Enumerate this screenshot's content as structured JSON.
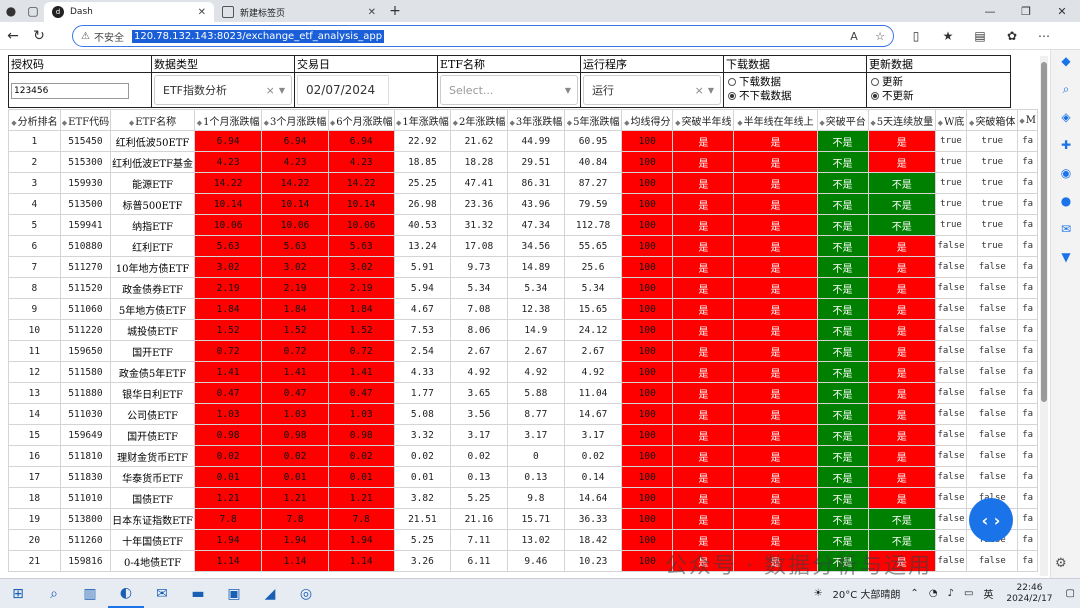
{
  "browser": {
    "tabs": [
      {
        "label": "Dash",
        "fav": "dash"
      },
      {
        "label": "新建标签页",
        "fav": "page"
      }
    ],
    "url": "120.78.132.143:8023/exchange_etf_analysis_app",
    "insecure_label": "不安全"
  },
  "controls": {
    "auth": {
      "label": "授权码",
      "value": "123456"
    },
    "datatype": {
      "label": "数据类型",
      "value": "ETF指数分析"
    },
    "tradedate": {
      "label": "交易日",
      "value": "02/07/2024"
    },
    "etfname": {
      "label": "ETF名称",
      "placeholder": "Select..."
    },
    "program": {
      "label": "运行程序",
      "value": "运行"
    },
    "download": {
      "label": "下载数据",
      "options": [
        "下载数据",
        "不下载数据"
      ],
      "selected": 1
    },
    "update": {
      "label": "更新数据",
      "options": [
        "更新",
        "不更新"
      ],
      "selected": 1
    }
  },
  "table": {
    "headers": [
      "分析排名",
      "ETF代码",
      "ETF名称",
      "1个月涨跌幅",
      "3个月涨跌幅",
      "6个月涨跌幅",
      "1年涨跌幅",
      "2年涨跌幅",
      "3年涨跌幅",
      "5年涨跌幅",
      "均线得分",
      "突破半年线",
      "半年线在年线上",
      "突破平台",
      "5天连续放量",
      "W底",
      "突破箱体",
      "M"
    ],
    "rows": [
      [
        "1",
        "515450",
        "红利低波50ETF",
        "6.94",
        "6.94",
        "6.94",
        "22.92",
        "21.62",
        "44.99",
        "60.95",
        "100",
        "是",
        "是",
        "不是",
        "是",
        "true",
        "true",
        "fa"
      ],
      [
        "2",
        "515300",
        "红利低波ETF基金",
        "4.23",
        "4.23",
        "4.23",
        "18.85",
        "18.28",
        "29.51",
        "40.84",
        "100",
        "是",
        "是",
        "不是",
        "是",
        "true",
        "true",
        "fa"
      ],
      [
        "3",
        "159930",
        "能源ETF",
        "14.22",
        "14.22",
        "14.22",
        "25.25",
        "47.41",
        "86.31",
        "87.27",
        "100",
        "是",
        "是",
        "不是",
        "不是",
        "true",
        "true",
        "fa"
      ],
      [
        "4",
        "513500",
        "标普500ETF",
        "10.14",
        "10.14",
        "10.14",
        "26.98",
        "23.36",
        "43.96",
        "79.59",
        "100",
        "是",
        "是",
        "不是",
        "不是",
        "true",
        "true",
        "fa"
      ],
      [
        "5",
        "159941",
        "纳指ETF",
        "10.06",
        "10.06",
        "10.06",
        "40.53",
        "31.32",
        "47.34",
        "112.78",
        "100",
        "是",
        "是",
        "不是",
        "不是",
        "true",
        "true",
        "fa"
      ],
      [
        "6",
        "510880",
        "红利ETF",
        "5.63",
        "5.63",
        "5.63",
        "13.24",
        "17.08",
        "34.56",
        "55.65",
        "100",
        "是",
        "是",
        "不是",
        "是",
        "false",
        "true",
        "fa"
      ],
      [
        "7",
        "511270",
        "10年地方债ETF",
        "3.02",
        "3.02",
        "3.02",
        "5.91",
        "9.73",
        "14.89",
        "25.6",
        "100",
        "是",
        "是",
        "不是",
        "是",
        "false",
        "false",
        "fa"
      ],
      [
        "8",
        "511520",
        "政金债券ETF",
        "2.19",
        "2.19",
        "2.19",
        "5.94",
        "5.34",
        "5.34",
        "5.34",
        "100",
        "是",
        "是",
        "不是",
        "是",
        "false",
        "false",
        "fa"
      ],
      [
        "9",
        "511060",
        "5年地方债ETF",
        "1.84",
        "1.84",
        "1.84",
        "4.67",
        "7.08",
        "12.38",
        "15.65",
        "100",
        "是",
        "是",
        "不是",
        "是",
        "false",
        "false",
        "fa"
      ],
      [
        "10",
        "511220",
        "城投债ETF",
        "1.52",
        "1.52",
        "1.52",
        "7.53",
        "8.06",
        "14.9",
        "24.12",
        "100",
        "是",
        "是",
        "不是",
        "是",
        "false",
        "false",
        "fa"
      ],
      [
        "11",
        "159650",
        "国开ETF",
        "0.72",
        "0.72",
        "0.72",
        "2.54",
        "2.67",
        "2.67",
        "2.67",
        "100",
        "是",
        "是",
        "不是",
        "是",
        "false",
        "false",
        "fa"
      ],
      [
        "12",
        "511580",
        "政金债5年ETF",
        "1.41",
        "1.41",
        "1.41",
        "4.33",
        "4.92",
        "4.92",
        "4.92",
        "100",
        "是",
        "是",
        "不是",
        "是",
        "false",
        "false",
        "fa"
      ],
      [
        "13",
        "511880",
        "银华日利ETF",
        "0.47",
        "0.47",
        "0.47",
        "1.77",
        "3.65",
        "5.88",
        "11.04",
        "100",
        "是",
        "是",
        "不是",
        "是",
        "false",
        "false",
        "fa"
      ],
      [
        "14",
        "511030",
        "公司债ETF",
        "1.03",
        "1.03",
        "1.03",
        "5.08",
        "3.56",
        "8.77",
        "14.67",
        "100",
        "是",
        "是",
        "不是",
        "是",
        "false",
        "false",
        "fa"
      ],
      [
        "15",
        "159649",
        "国开债ETF",
        "0.98",
        "0.98",
        "0.98",
        "3.32",
        "3.17",
        "3.17",
        "3.17",
        "100",
        "是",
        "是",
        "不是",
        "是",
        "false",
        "false",
        "fa"
      ],
      [
        "16",
        "511810",
        "理财金货币ETF",
        "0.02",
        "0.02",
        "0.02",
        "0.02",
        "0.02",
        "0",
        "0.02",
        "100",
        "是",
        "是",
        "不是",
        "是",
        "false",
        "false",
        "fa"
      ],
      [
        "17",
        "511830",
        "华泰货币ETF",
        "0.01",
        "0.01",
        "0.01",
        "0.01",
        "0.13",
        "0.13",
        "0.14",
        "100",
        "是",
        "是",
        "不是",
        "是",
        "false",
        "false",
        "fa"
      ],
      [
        "18",
        "511010",
        "国债ETF",
        "1.21",
        "1.21",
        "1.21",
        "3.82",
        "5.25",
        "9.8",
        "14.64",
        "100",
        "是",
        "是",
        "不是",
        "是",
        "false",
        "false",
        "fa"
      ],
      [
        "19",
        "513800",
        "日本东证指数ETF",
        "7.8",
        "7.8",
        "7.8",
        "21.51",
        "21.16",
        "15.71",
        "36.33",
        "100",
        "是",
        "是",
        "不是",
        "不是",
        "false",
        "false",
        "fa"
      ],
      [
        "20",
        "511260",
        "十年国债ETF",
        "1.94",
        "1.94",
        "1.94",
        "5.25",
        "7.11",
        "13.02",
        "18.42",
        "100",
        "是",
        "是",
        "不是",
        "不是",
        "false",
        "false",
        "fa"
      ],
      [
        "21",
        "159816",
        "0-4地债ETF",
        "1.14",
        "1.14",
        "1.14",
        "3.26",
        "6.11",
        "9.46",
        "10.23",
        "100",
        "是",
        "是",
        "不是",
        "是",
        "false",
        "false",
        "fa"
      ]
    ]
  },
  "watermark": "公众号 · 数据分析与运用",
  "taskbar": {
    "weather": "20°C 大部晴朗",
    "ime": "英",
    "time": "22:46",
    "date": "2024/2/17"
  },
  "colors": {
    "red": "#ff0000",
    "green": "#008000"
  }
}
